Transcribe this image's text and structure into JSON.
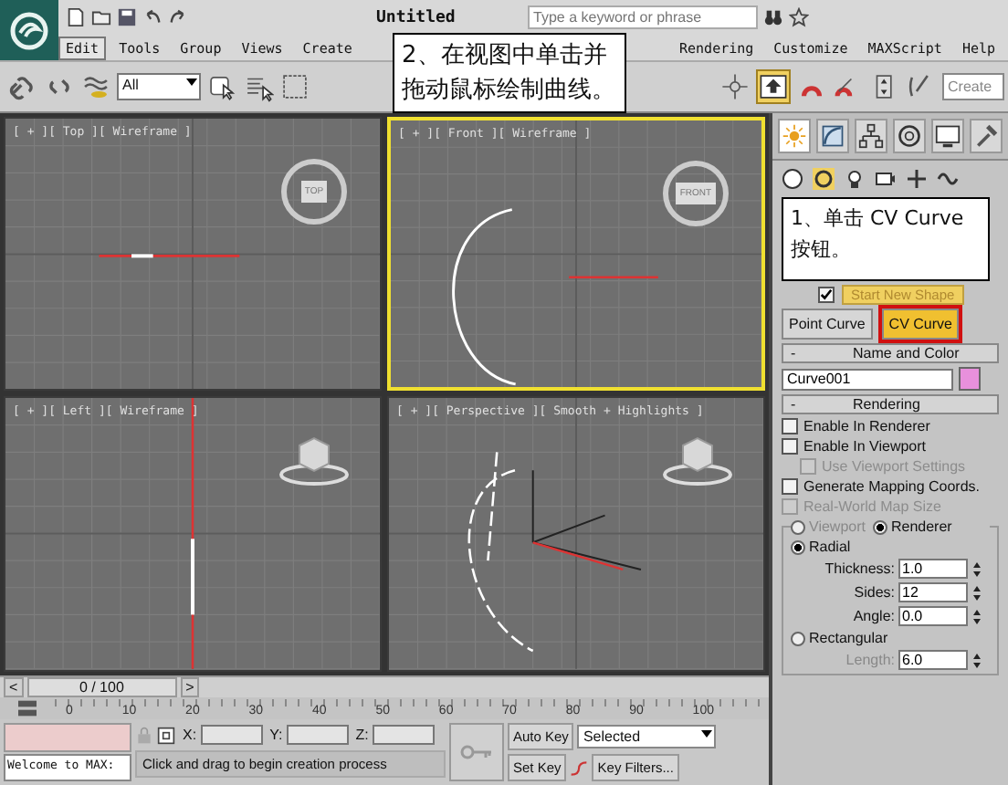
{
  "title_bar": {
    "title": "Untitled",
    "search": {
      "placeholder": "Type a keyword or phrase"
    }
  },
  "menu": {
    "left": [
      {
        "label": "Edit",
        "selected": true
      },
      {
        "label": "Tools",
        "selected": false
      },
      {
        "label": "Group",
        "selected": false
      },
      {
        "label": "Views",
        "selected": false
      },
      {
        "label": "Create",
        "selected": false
      }
    ],
    "right": [
      {
        "label": "Rendering",
        "selected": false
      },
      {
        "label": "Customize",
        "selected": false
      },
      {
        "label": "MAXScript",
        "selected": false
      },
      {
        "label": "Help",
        "selected": false
      }
    ]
  },
  "toolbar": {
    "filter": "All",
    "selection_set": "Create"
  },
  "viewports": [
    {
      "label": "[ + ][ Top ][ Wireframe ]",
      "active": false,
      "kind": "top",
      "cube_label": "TOP"
    },
    {
      "label": "[ + ][ Front ][ Wireframe ]",
      "active": true,
      "kind": "front",
      "cube_label": "FRONT"
    },
    {
      "label": "[ + ][ Left ][ Wireframe ]",
      "active": false,
      "kind": "left"
    },
    {
      "label": "[ + ][ Perspective ][ Smooth + Highlights ]",
      "active": false,
      "kind": "perspective"
    }
  ],
  "callouts": [
    {
      "text": "2、在视图中单击并拖动鼠标绘制曲线。"
    },
    {
      "text": "1、单击 CV Curve 按钮。"
    }
  ],
  "command_panel": {
    "start_new_shape": {
      "checked": true,
      "label": "Start New Shape"
    },
    "object_buttons": [
      {
        "label": "Point Curve",
        "selected": false
      },
      {
        "label": "CV Curve",
        "selected": true
      }
    ],
    "name_rollout": {
      "collapse": "-",
      "title": "Name and Color",
      "name": "Curve001",
      "color": "#e890dc"
    },
    "rendering_rollout": {
      "collapse": "-",
      "title": "Rendering",
      "options": [
        {
          "label": "Enable In Renderer",
          "checked": false,
          "disabled": false
        },
        {
          "label": "Enable In Viewport",
          "checked": false,
          "disabled": false,
          "children": [
            {
              "label": "Use Viewport Settings",
              "checked": false,
              "disabled": true
            }
          ]
        },
        {
          "label": "Generate Mapping Coords.",
          "checked": false,
          "disabled": false
        },
        {
          "label": "Real-World Map Size",
          "checked": false,
          "disabled": true
        }
      ],
      "modes": [
        {
          "label": "Viewport",
          "selected": false
        },
        {
          "label": "Renderer",
          "selected": true
        }
      ],
      "radial": {
        "label": "Radial",
        "selected": true,
        "fields": [
          {
            "label": "Thickness:",
            "value": "1.0"
          },
          {
            "label": "Sides:",
            "value": "12"
          },
          {
            "label": "Angle:",
            "value": "0.0"
          }
        ]
      },
      "rectangular": {
        "label": "Rectangular",
        "selected": false,
        "fields": [
          {
            "label": "Length:",
            "value": "6.0"
          }
        ]
      }
    }
  },
  "time_slider": {
    "prev": "<",
    "position": "0 / 100",
    "next": ">"
  },
  "track_ticks": [
    "0",
    "10",
    "20",
    "30",
    "40",
    "50",
    "60",
    "70",
    "80",
    "90",
    "100"
  ],
  "status": {
    "listener": "Welcome to MAX:",
    "coords": [
      "X:",
      "Y:",
      "Z:"
    ],
    "prompt": "Click and drag to begin creation process",
    "auto_key": "Auto Key",
    "set_key": "Set Key",
    "key_mode": "Selected",
    "key_filters": "Key Filters..."
  }
}
